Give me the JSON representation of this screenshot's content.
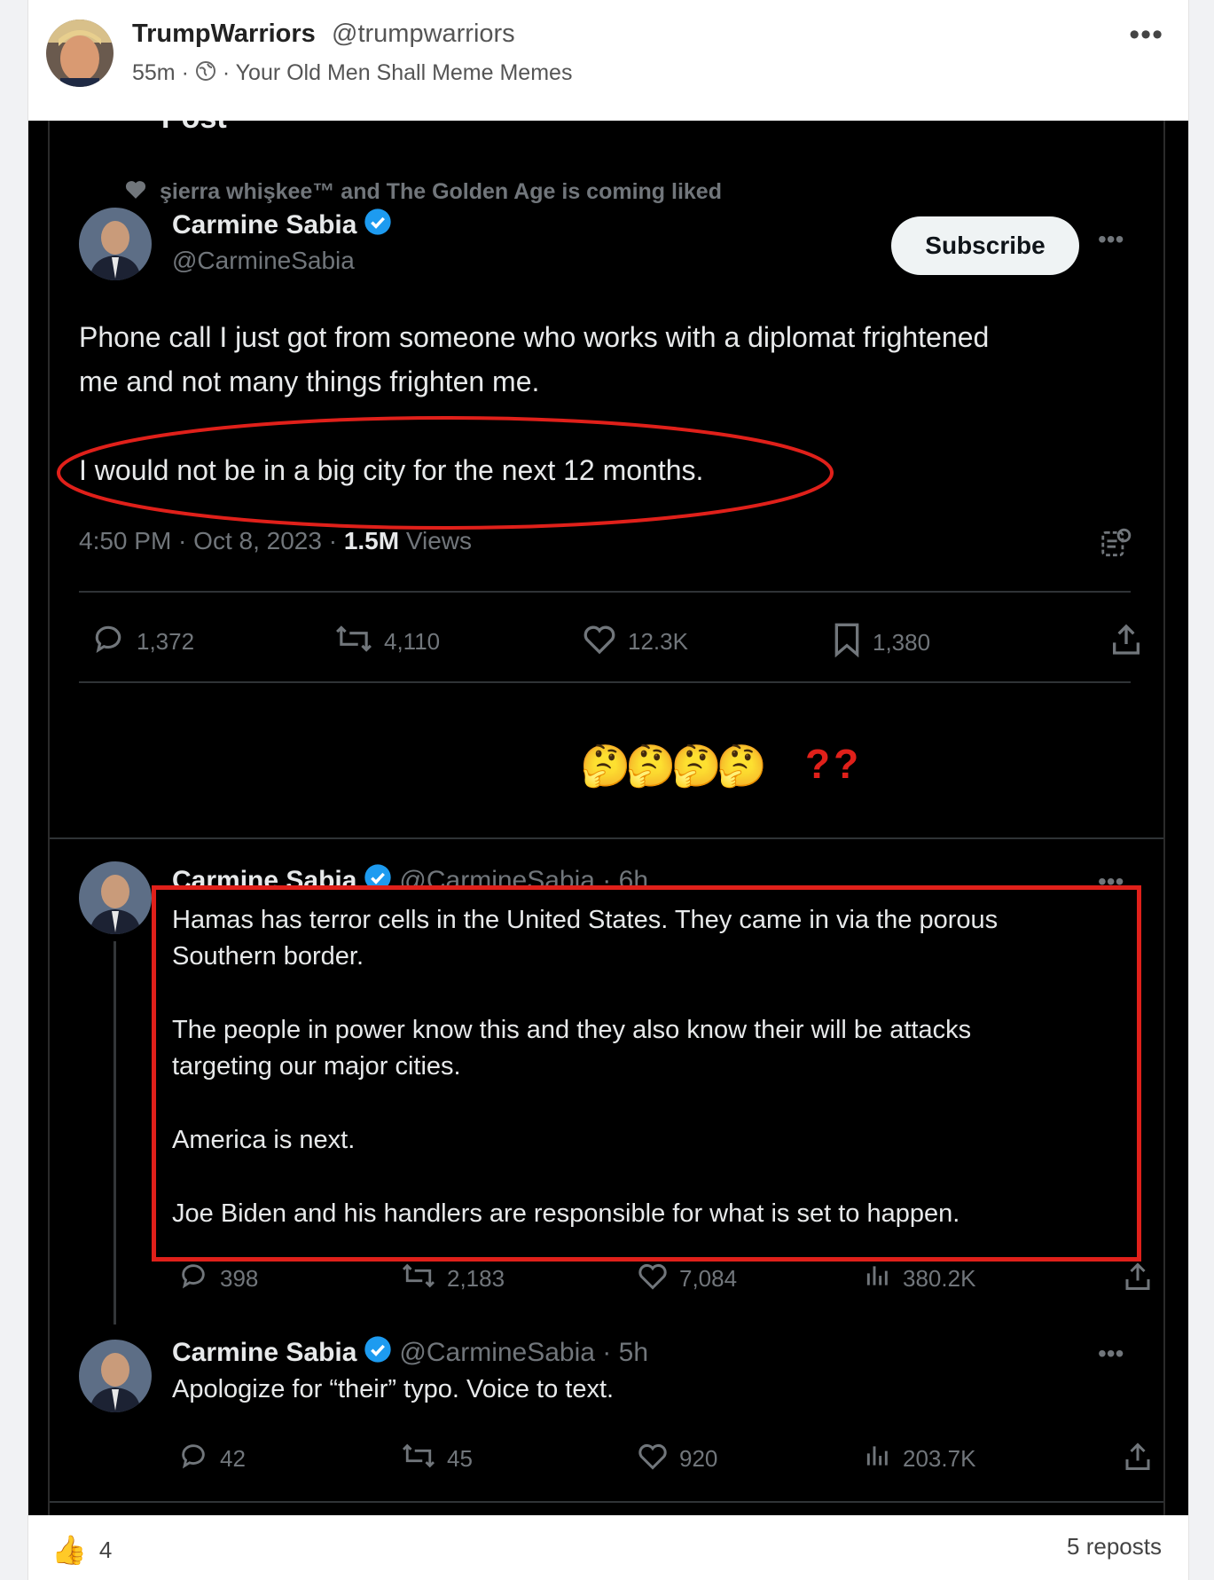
{
  "post": {
    "author_name": "TrumpWarriors",
    "author_handle": "@trumpwarriors",
    "time": "55m",
    "dot": "·",
    "group": "Your Old Men Shall Meme Memes",
    "more_icon": "more-horizontal-icon"
  },
  "screenshot": {
    "top_title": "Post",
    "liked_by": "şierra whişkee™ and The Golden Age is coming liked",
    "main_tweet": {
      "name": "Carmine Sabia",
      "handle": "@CarmineSabia",
      "subscribe": "Subscribe",
      "text1": "Phone call I just got from someone who works with a diplomat frightened",
      "text2": "me and not many things frighten me.",
      "text3": "I would not be in a big city for the next 12 months.",
      "timestamp": "4:50 PM · Oct 8, 2023 · ",
      "views_count": "1.5M",
      "views_label": " Views",
      "replies": "1,372",
      "reposts": "4,110",
      "likes": "12.3K",
      "bookmarks": "1,380"
    },
    "reaction_emoji": "🤔🤔🤔🤔",
    "reaction_marks": "??",
    "thread_tweet_1": {
      "name": "Carmine Sabia",
      "handle": "@CarmineSabia · 6h",
      "p1a": "Hamas has terror cells in the United States. They came in via the porous",
      "p1b": "Southern border.",
      "p2a": "The people in power know this and they also know their will be attacks",
      "p2b": "targeting our major cities.",
      "p3": "America is next.",
      "p4": "Joe Biden and his handlers are responsible for what is set to happen.",
      "replies": "398",
      "reposts": "2,183",
      "likes": "7,084",
      "views": "380.2K"
    },
    "thread_tweet_2": {
      "name": "Carmine Sabia",
      "handle": "@CarmineSabia · 5h",
      "text": "Apologize for “their” typo. Voice to text.",
      "replies": "42",
      "reposts": "45",
      "likes": "920",
      "views": "203.7K"
    },
    "annotation_color": "#e0201a",
    "verified_color": "#1d9bf0"
  },
  "footer": {
    "like_count": "4",
    "reposts": "5 reposts"
  }
}
